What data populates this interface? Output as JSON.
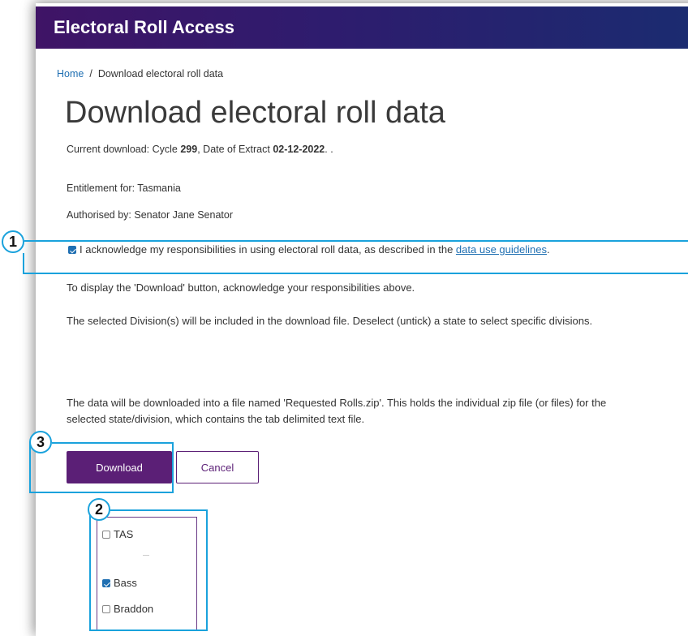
{
  "header": {
    "title": "Electoral Roll Access"
  },
  "breadcrumb": {
    "home": "Home",
    "separator": "/",
    "current": "Download electoral roll data"
  },
  "page": {
    "title": "Download electoral roll data",
    "current_download_prefix": "Current download: Cycle ",
    "cycle": "299",
    "extract_prefix": ", Date of Extract ",
    "extract_date": "02-12-2022",
    "extract_suffix": ". .",
    "entitlement": "Entitlement for: Tasmania",
    "authorised": "Authorised by: Senator Jane Senator"
  },
  "acknowledge": {
    "checked": true,
    "text": "I acknowledge my responsibilities in using electoral roll data, as described in the ",
    "link_text": "data use guidelines",
    "suffix": "."
  },
  "info": {
    "download_hint": "To display the 'Download' button, acknowledge your responsibilities above.",
    "division_note": "The selected Division(s) will be included in the download file. Deselect (untick) a state to select specific divisions.",
    "file_note": "The data will be downloaded into a file named 'Requested Rolls.zip'. This holds the individual zip file (or files) for the selected state/division, which contains the tab delimited text file."
  },
  "buttons": {
    "download": "Download",
    "cancel": "Cancel"
  },
  "divisions": {
    "state": {
      "label": "TAS",
      "checked": false
    },
    "items": [
      {
        "label": "Bass",
        "checked": true
      },
      {
        "label": "Braddon",
        "checked": false
      }
    ]
  },
  "callouts": [
    "1",
    "2",
    "3"
  ],
  "colors": {
    "header_start": "#3f1466",
    "header_end": "#1b2b70",
    "primary_button": "#5b1f76",
    "link": "#1f6fb2",
    "callout": "#1aa2dc"
  }
}
